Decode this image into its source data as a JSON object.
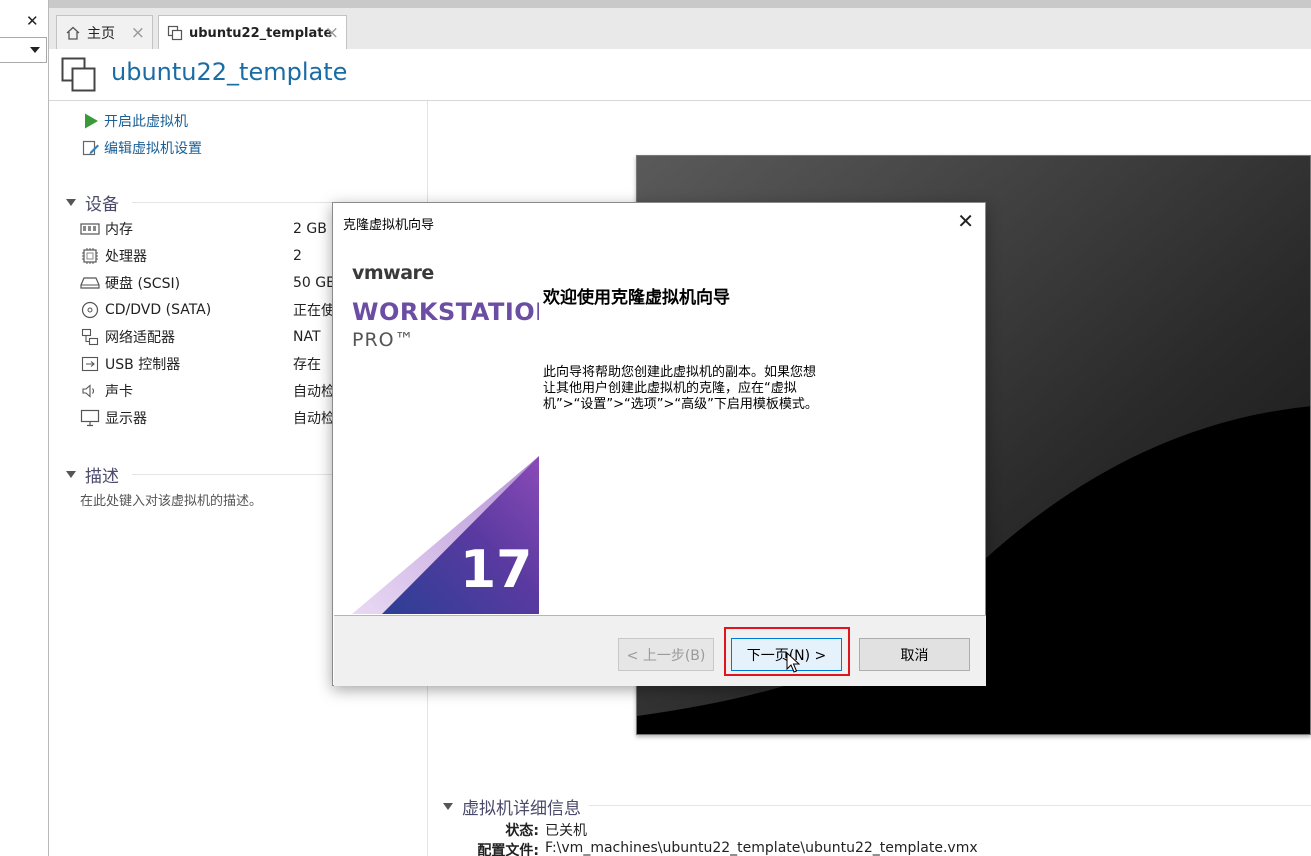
{
  "sidebar": {
    "close_glyph": "✕"
  },
  "tabs": [
    {
      "label": "主页",
      "icon": "home-icon"
    },
    {
      "label": "ubuntu22_template",
      "icon": "vm-copy-icon"
    }
  ],
  "vm": {
    "title": "ubuntu22_template"
  },
  "actions": {
    "start": "开启此虚拟机",
    "edit": "编辑虚拟机设置"
  },
  "devices": {
    "title": "设备",
    "items": [
      {
        "name": "内存",
        "value": "2 GB",
        "icon": "memory-icon"
      },
      {
        "name": "处理器",
        "value": "2",
        "icon": "cpu-icon"
      },
      {
        "name": "硬盘 (SCSI)",
        "value": "50 GB",
        "icon": "hard-disk-icon"
      },
      {
        "name": "CD/DVD (SATA)",
        "value": "正在使",
        "icon": "cd-dvd-icon"
      },
      {
        "name": "网络适配器",
        "value": "NAT",
        "icon": "network-adapter-icon"
      },
      {
        "name": "USB 控制器",
        "value": "存在",
        "icon": "usb-icon"
      },
      {
        "name": "声卡",
        "value": "自动检",
        "icon": "sound-card-icon"
      },
      {
        "name": "显示器",
        "value": "自动检",
        "icon": "display-icon"
      }
    ]
  },
  "description": {
    "title": "描述",
    "placeholder": "在此处键入对该虚拟机的描述。"
  },
  "details": {
    "title": "虚拟机详细信息",
    "state_label": "状态:",
    "state_value": "已关机",
    "config_label": "配置文件:",
    "config_value": "F:\\vm_machines\\ubuntu22_template\\ubuntu22_template.vmx"
  },
  "dialog": {
    "title": "克隆虚拟机向导",
    "close_glyph": "✕",
    "brand": {
      "logo": "vmware",
      "product": "WORKSTATION",
      "edition": "PRO™",
      "version": "17"
    },
    "heading": "欢迎使用克隆虚拟机向导",
    "body": "此向导将帮助您创建此虚拟机的副本。如果您想让其他用户创建此虚拟机的克隆，应在“虚拟机”>“设置”>“选项”>“高级”下启用模板模式。",
    "buttons": {
      "prev": "< 上一步(B)",
      "next": "下一页(N) >",
      "cancel": "取消"
    }
  },
  "colors": {
    "accent_blue": "#1a6ca5",
    "brand_purple": "#6b4ea3",
    "highlight_red": "#e0141e",
    "start_green": "#3a9a3a"
  }
}
